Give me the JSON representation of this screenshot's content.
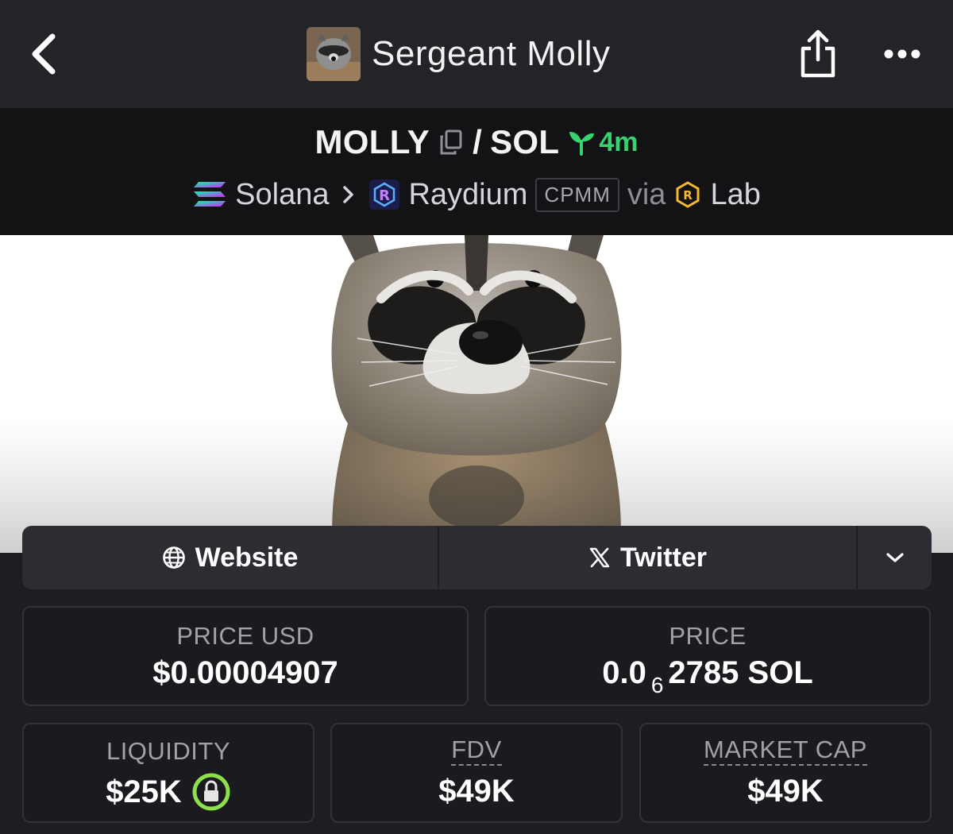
{
  "header": {
    "title": "Sergeant Molly",
    "back_icon": "chevron-left-icon",
    "share_icon": "share-icon",
    "more_icon": "more-dots-icon"
  },
  "pair": {
    "base": "MOLLY",
    "separator": "/",
    "quote": "SOL",
    "age": "4m",
    "chain": "Solana",
    "dex": "Raydium",
    "pool_type": "CPMM",
    "via_label": "via",
    "via_name": "Lab"
  },
  "links": {
    "website": "Website",
    "twitter": "Twitter"
  },
  "stats": {
    "price_usd_label": "PRICE USD",
    "price_usd": "$0.00004907",
    "price_label": "PRICE",
    "price_prefix": "0.0",
    "price_subscript": "6",
    "price_suffix": "2785 SOL",
    "liquidity_label": "LIQUIDITY",
    "liquidity": "$25K",
    "fdv_label": "FDV",
    "fdv": "$49K",
    "mcap_label": "MARKET CAP",
    "mcap": "$49K"
  },
  "colors": {
    "background": "#1d1d22",
    "appbar": "#232328",
    "pairbar": "#131316",
    "age_green": "#38d36e",
    "lock_green": "#8ee04a"
  }
}
